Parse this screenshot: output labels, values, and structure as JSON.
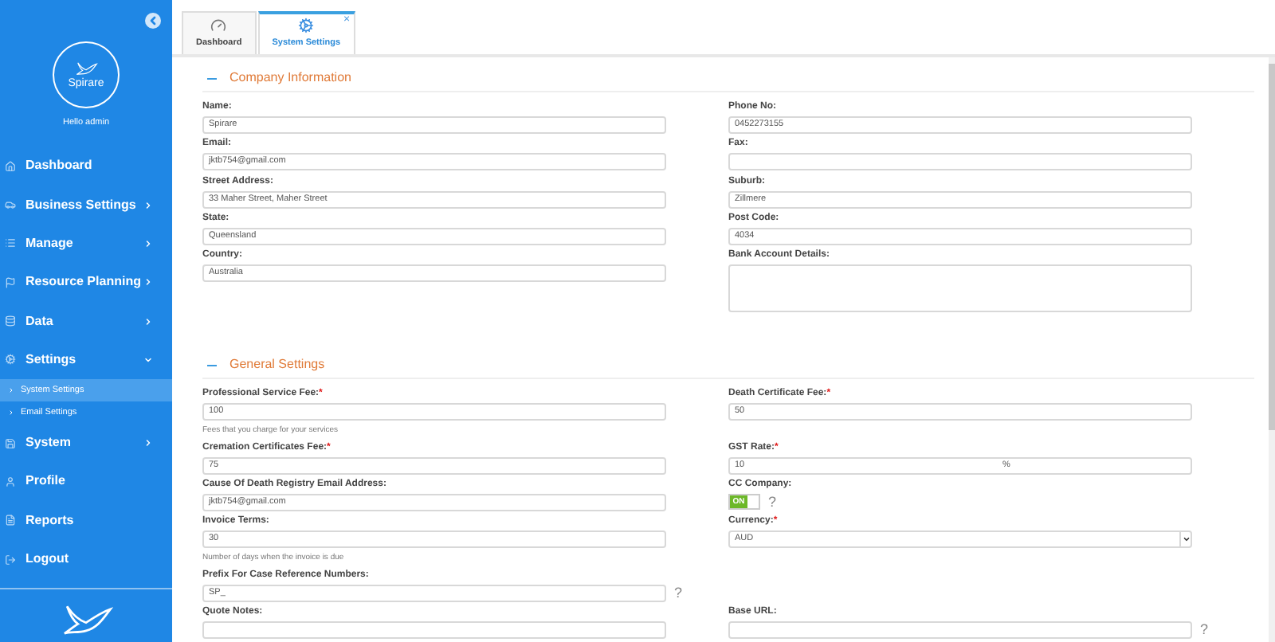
{
  "sidebar": {
    "brand": "Spirare",
    "greeting": "Hello admin",
    "items": [
      {
        "label": "Dashboard",
        "kind": "link",
        "selected": false
      },
      {
        "label": "Business Settings",
        "kind": "group",
        "expanded": false,
        "selected": false
      },
      {
        "label": "Manage",
        "kind": "group",
        "expanded": false,
        "selected": false
      },
      {
        "label": "Resource Planning",
        "kind": "group",
        "expanded": false,
        "selected": false
      },
      {
        "label": "Data",
        "kind": "group",
        "expanded": false,
        "selected": false
      },
      {
        "label": "Settings",
        "kind": "group",
        "expanded": true,
        "selected": false,
        "children": [
          {
            "label": "System Settings",
            "selected": true
          },
          {
            "label": "Email Settings",
            "selected": false
          }
        ]
      },
      {
        "label": "System",
        "kind": "group",
        "expanded": false,
        "selected": false
      },
      {
        "label": "Profile",
        "kind": "link",
        "selected": false
      },
      {
        "label": "Reports",
        "kind": "link",
        "selected": false
      },
      {
        "label": "Logout",
        "kind": "link",
        "selected": false
      }
    ]
  },
  "tabs": [
    {
      "label": "Dashboard",
      "selected": false
    },
    {
      "label": "System Settings",
      "selected": true,
      "close": "×"
    }
  ],
  "sections": [
    {
      "title": "Company Information",
      "rows": [
        [
          {
            "kind": "text",
            "label": "Name:",
            "value": "Spirare"
          },
          {
            "kind": "text",
            "label": "Phone No:",
            "value": "0452273155"
          }
        ],
        [
          {
            "kind": "text",
            "label": "Email:",
            "value": "jktb754@gmail.com"
          },
          {
            "kind": "text",
            "label": "Fax:"
          }
        ],
        [
          {
            "kind": "text",
            "label": "Street Address:",
            "value": "33 Maher Street, Maher Street"
          },
          {
            "kind": "text",
            "label": "Suburb:",
            "value": "Zillmere"
          }
        ],
        [
          {
            "kind": "text",
            "label": "State:",
            "value": "Queensland"
          },
          {
            "kind": "text",
            "label": "Post Code:",
            "value": "4034"
          }
        ],
        [
          {
            "kind": "text",
            "label": "Country:",
            "value": "Australia"
          },
          {
            "kind": "textarea",
            "label": "Bank Account Details:"
          }
        ]
      ]
    },
    {
      "title": "General Settings",
      "rows": [
        [
          {
            "kind": "text",
            "label": "Professional Service Fee:",
            "required_mark": "*",
            "value": "100",
            "help": "Fees that you charge for your services"
          },
          {
            "kind": "text",
            "label": "Death Certificate Fee:",
            "required_mark": "*",
            "value": "50"
          }
        ],
        [
          {
            "kind": "text",
            "label": "Cremation Certificates Fee:",
            "required_mark": "*",
            "value": "75"
          },
          {
            "kind": "percent",
            "label": "GST Rate:",
            "required_mark": "*",
            "value": "10",
            "suffix": "%"
          }
        ],
        [
          {
            "kind": "text",
            "label": "Cause Of Death Registry Email Address:",
            "value": "jktb754@gmail.com"
          },
          {
            "kind": "toggle",
            "label": "CC Company:",
            "on": true,
            "on_text": "ON",
            "question": "?"
          }
        ],
        [
          {
            "kind": "text",
            "label": "Invoice Terms:",
            "value": "30",
            "help": "Number of days when the invoice is due"
          },
          {
            "kind": "select",
            "label": "Currency:",
            "required_mark": "*",
            "value": "AUD"
          }
        ],
        [
          {
            "kind": "text",
            "label": "Prefix For Case Reference Numbers:",
            "value": "SP_",
            "question": "?"
          },
          null
        ],
        [
          {
            "kind": "text",
            "label": "Quote Notes:"
          },
          {
            "kind": "text",
            "label": "Base URL:",
            "question": "?"
          }
        ]
      ]
    }
  ]
}
